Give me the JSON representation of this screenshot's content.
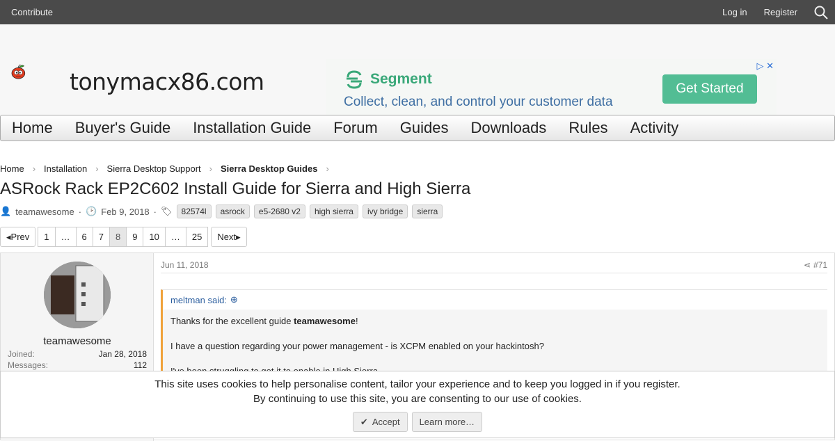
{
  "topbar": {
    "contribute": "Contribute",
    "login": "Log in",
    "register": "Register"
  },
  "site": {
    "name": "tonymacx86.com"
  },
  "ad": {
    "brand": "Segment",
    "line": "Collect, clean, and control your customer data",
    "cta": "Get Started"
  },
  "nav": [
    "Home",
    "Buyer's Guide",
    "Installation Guide",
    "Forum",
    "Guides",
    "Downloads",
    "Rules",
    "Activity"
  ],
  "breadcrumb": [
    "Home",
    "Installation",
    "Sierra Desktop Support",
    "Sierra Desktop Guides"
  ],
  "thread": {
    "title": "ASRock Rack EP2C602 Install Guide for Sierra and High Sierra",
    "author": "teamawesome",
    "date": "Feb 9, 2018",
    "tags": [
      "82574l",
      "asrock",
      "e5-2680 v2",
      "high sierra",
      "ivy bridge",
      "sierra"
    ]
  },
  "pagination": {
    "prev": "Prev",
    "next": "Next",
    "pages": [
      "1",
      "…",
      "6",
      "7",
      "8",
      "9",
      "10",
      "…",
      "25"
    ],
    "current": "8"
  },
  "post": {
    "username": "teamawesome",
    "joined_label": "Joined:",
    "joined": "Jan 28, 2018",
    "messages_label": "Messages:",
    "messages": "112",
    "date": "Jun 11, 2018",
    "number": "#71",
    "quote_author": "meltman said:",
    "quote_line1_prefix": "Thanks for the excellent guide ",
    "quote_line1_bold": "teamawesome",
    "quote_line1_suffix": "!",
    "quote_line2": "I have a question regarding your power management - is XCPM enabled on your hackintosh?",
    "quote_line3": "I've been struggling to get it to enable in High Sierra."
  },
  "cookie": {
    "line1": "This site uses cookies to help personalise content, tailor your experience and to keep you logged in if you register.",
    "line2": "By continuing to use this site, you are consenting to our use of cookies.",
    "accept": "Accept",
    "learn": "Learn more…"
  }
}
